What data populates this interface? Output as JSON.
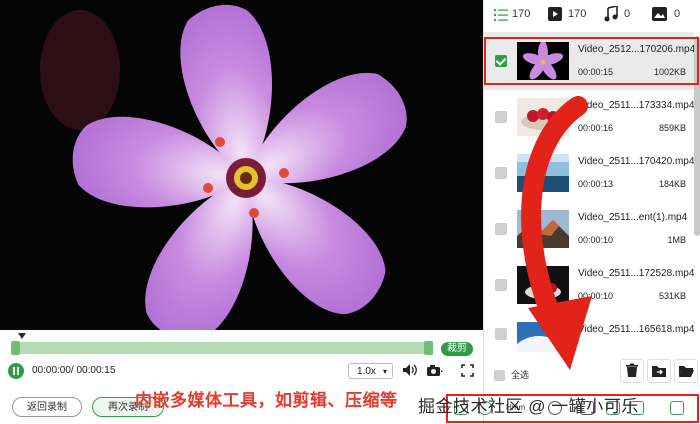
{
  "player": {
    "trim_label": "裁剪",
    "time_text": "00:00:00/ 00:00:15",
    "speed": "1.0x",
    "back_button": "返回录制",
    "rerecord_button": "再次录制"
  },
  "panel": {
    "counts": {
      "all": "170",
      "video": "170",
      "audio": "0",
      "image": "0"
    },
    "files": [
      {
        "name": "Video_2512...170206.mp4",
        "duration": "00:00:15",
        "size": "1002KB",
        "selected": true
      },
      {
        "name": "Video_2511...173334.mp4",
        "duration": "00:00:16",
        "size": "859KB",
        "selected": false
      },
      {
        "name": "Video_2511...170420.mp4",
        "duration": "00:00:13",
        "size": "184KB",
        "selected": false
      },
      {
        "name": "Video_2511...ent(1).mp4",
        "duration": "00:00:10",
        "size": "1MB",
        "selected": false
      },
      {
        "name": "Video_2511...172528.mp4",
        "duration": "00:00:10",
        "size": "531KB",
        "selected": false
      },
      {
        "name": "Video_2511...165618.mp4",
        "duration": "",
        "size": "",
        "selected": false
      }
    ],
    "select_all": "全选",
    "toolbar_label": "Hmm"
  },
  "annotation": {
    "caption": "内嵌多媒体工具，如剪辑、压缩等",
    "watermark": "掘金技术社区 @ 一罐小可乐"
  },
  "colors": {
    "accent": "#2e9e46",
    "highlight": "#e2231a",
    "flower": "#c88be0"
  }
}
